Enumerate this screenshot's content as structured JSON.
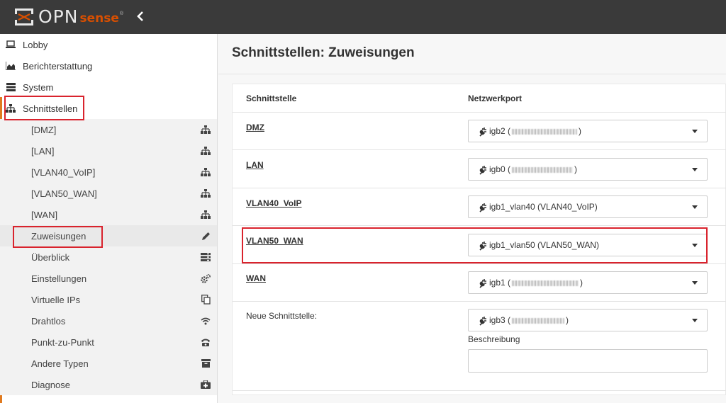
{
  "header": {
    "logo_text": "OPN",
    "logo_accent": "sense",
    "logo_reg": "®",
    "collapse_icon": "‹"
  },
  "sidebar": {
    "items": [
      {
        "label": "Lobby",
        "icon": "laptop-icon"
      },
      {
        "label": "Berichterstattung",
        "icon": "area-chart-icon"
      },
      {
        "label": "System",
        "icon": "server-icon"
      },
      {
        "label": "Schnittstellen",
        "icon": "sitemap-icon"
      }
    ],
    "sub_items": [
      {
        "label": "[DMZ]",
        "icon": "sitemap-icon"
      },
      {
        "label": "[LAN]",
        "icon": "sitemap-icon"
      },
      {
        "label": "[VLAN40_VoIP]",
        "icon": "sitemap-icon"
      },
      {
        "label": "[VLAN50_WAN]",
        "icon": "sitemap-icon"
      },
      {
        "label": "[WAN]",
        "icon": "sitemap-icon"
      },
      {
        "label": "Zuweisungen",
        "icon": "pencil-icon"
      },
      {
        "label": "Überblick",
        "icon": "list-icon"
      },
      {
        "label": "Einstellungen",
        "icon": "cogs-icon"
      },
      {
        "label": "Virtuelle IPs",
        "icon": "copy-icon"
      },
      {
        "label": "Drahtlos",
        "icon": "wifi-icon"
      },
      {
        "label": "Punkt-zu-Punkt",
        "icon": "phone-icon"
      },
      {
        "label": "Andere Typen",
        "icon": "archive-icon"
      },
      {
        "label": "Diagnose",
        "icon": "medkit-icon"
      }
    ]
  },
  "main": {
    "title": "Schnittstellen: Zuweisungen",
    "col_interface": "Schnittstelle",
    "col_port": "Netzwerkport",
    "rows": [
      {
        "name": "DMZ",
        "port": "igb2 (",
        "suffix": ")"
      },
      {
        "name": "LAN",
        "port": "igb0 (",
        "suffix": ")"
      },
      {
        "name": "VLAN40_VoIP",
        "port": "igb1_vlan40 (VLAN40_VoIP)",
        "suffix": ""
      },
      {
        "name": "VLAN50_WAN",
        "port": "igb1_vlan50 (VLAN50_WAN)",
        "suffix": ""
      },
      {
        "name": "WAN",
        "port": "igb1 (",
        "suffix": ")"
      }
    ],
    "new_interface_label": "Neue Schnittstelle:",
    "new_interface_port": "igb3 (",
    "new_interface_suffix": ")",
    "description_label": "Beschreibung",
    "description_value": ""
  },
  "colors": {
    "topbar": "#3a3a3a",
    "accent": "#d94f00",
    "highlight": "#d9232d",
    "sidebar_strip": "#e07a1f"
  }
}
